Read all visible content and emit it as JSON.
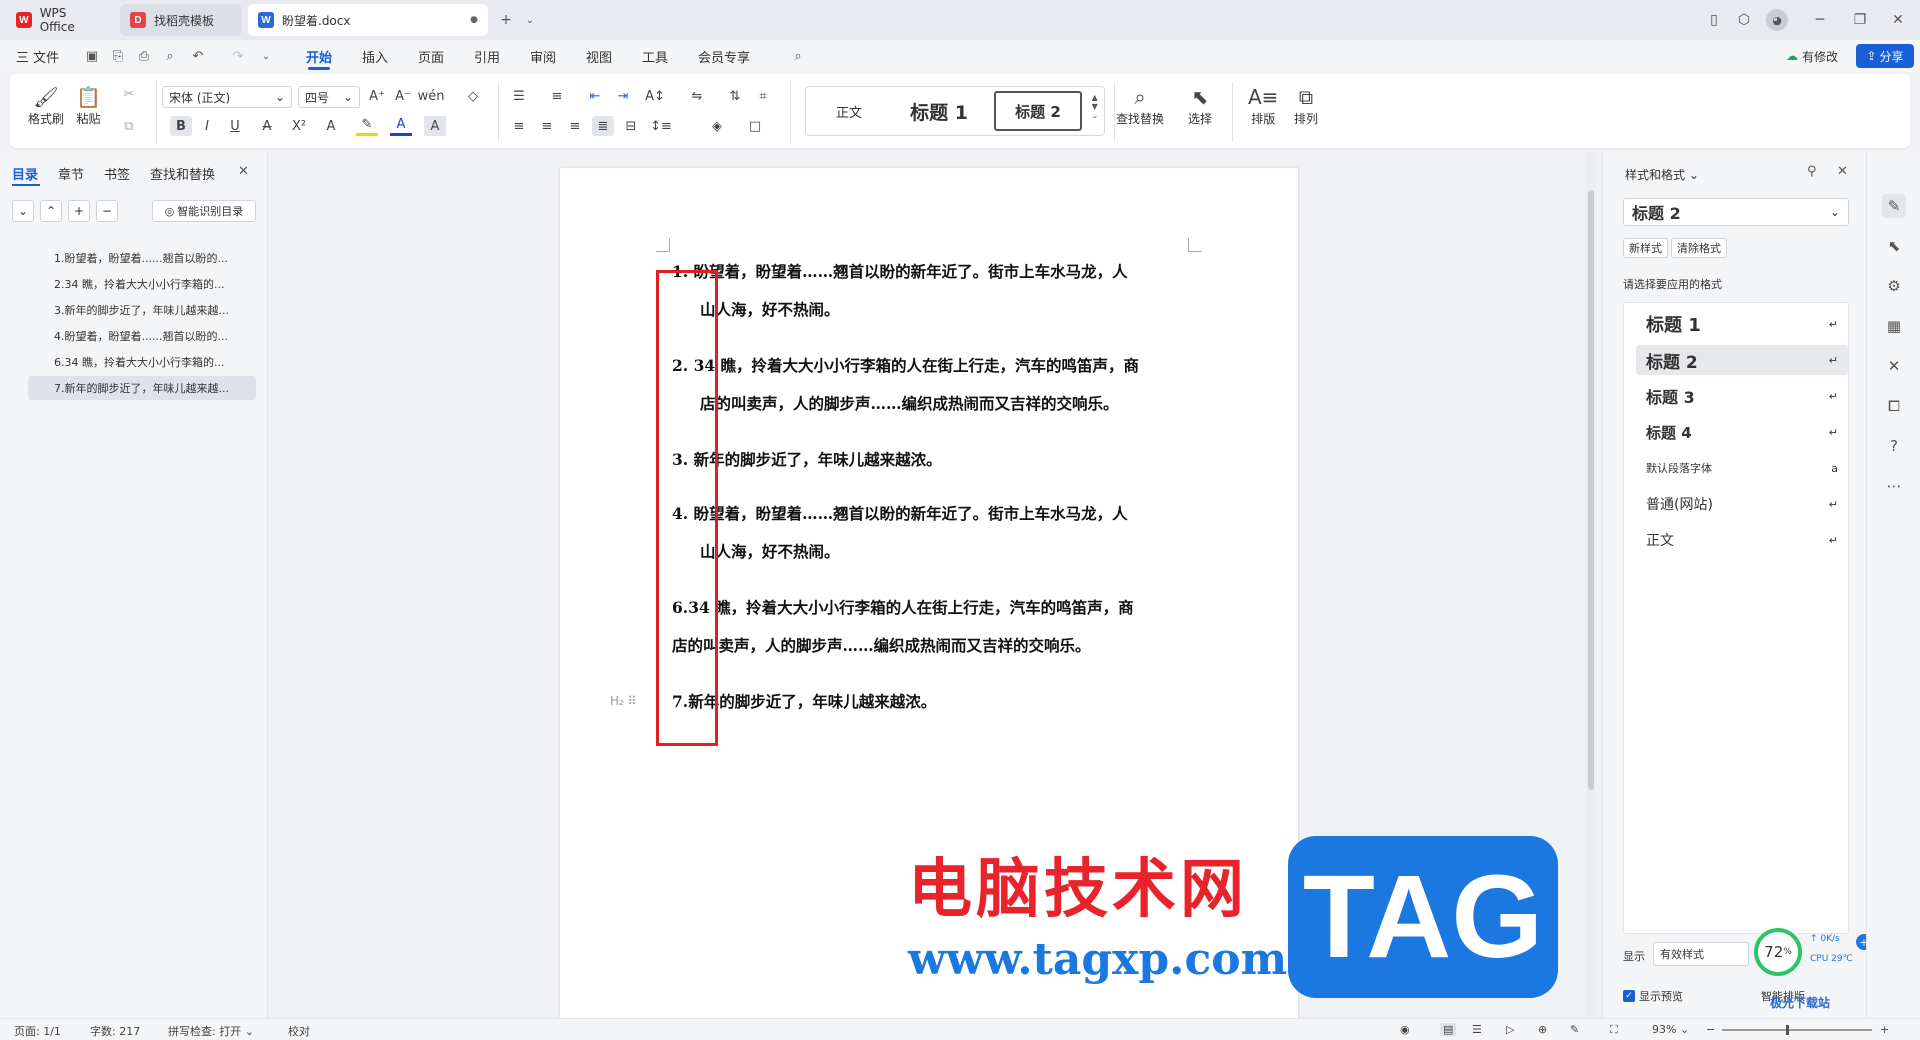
{
  "tabs": [
    {
      "label": "WPS Office",
      "icon": "wps-logo-icon"
    },
    {
      "label": "找稻壳模板",
      "icon": "docer-icon"
    },
    {
      "label": "盼望着.docx",
      "icon": "word-doc-icon"
    }
  ],
  "menu": {
    "file": "三 文件",
    "items": [
      "开始",
      "插入",
      "页面",
      "引用",
      "审阅",
      "视图",
      "工具",
      "会员专享"
    ],
    "active": "开始",
    "modified_label": "有修改",
    "share_label": "分享"
  },
  "ribbon": {
    "format_painter": "格式刷",
    "paste": "粘贴",
    "font_name": "宋体 (正文)",
    "font_size": "四号",
    "styles": [
      "正文",
      "标题 1",
      "标题 2"
    ],
    "find_replace": "查找替换",
    "select": "选择",
    "typeset": "排版",
    "arrange": "排列"
  },
  "left_panel": {
    "tabs": [
      "目录",
      "章节",
      "书签",
      "查找和替换"
    ],
    "smart_toc": "智能识别目录",
    "toc_items": [
      "1.盼望着，盼望着......翘首以盼的...",
      "2.34 瞧，拎着大大小小行李箱的...",
      "3.新年的脚步近了，年味儿越来越...",
      "4.盼望着，盼望着......翘首以盼的...",
      "6.34 瞧，拎着大大小小行李箱的...",
      "7.新年的脚步近了，年味儿越来越..."
    ]
  },
  "document": {
    "paragraphs": [
      {
        "num": "1.",
        "line1": "盼望着，盼望着……翘首以盼的新年近了。街市上车水马龙，人",
        "line2": "山人海，好不热闹。"
      },
      {
        "num": "2.",
        "line1": "34 瞧，拎着大大小小行李箱的人在街上行走，汽车的鸣笛声，商",
        "line2": "店的叫卖声，人的脚步声……编织成热闹而又吉祥的交响乐。"
      },
      {
        "num": "3.",
        "line1": "新年的脚步近了，年味儿越来越浓。"
      },
      {
        "num": "4.",
        "line1": "盼望着，盼望着……翘首以盼的新年近了。街市上车水马龙，人",
        "line2": "山人海，好不热闹。"
      },
      {
        "num": "6.",
        "line1": "34 瞧，拎着大大小小行李箱的人在街上行走，汽车的鸣笛声，商",
        "line2": "店的叫卖声，人的脚步声……编织成热闹而又吉祥的交响乐。"
      },
      {
        "num": "7.",
        "line1": "新年的脚步近了，年味儿越来越浓。"
      }
    ],
    "heading_marker": "H₂"
  },
  "right_panel": {
    "title": "样式和格式",
    "current_style": "标题 2",
    "new_style": "新样式",
    "clear_format": "清除格式",
    "hint": "请选择要应用的格式",
    "styles": [
      "标题 1",
      "标题 2",
      "标题 3",
      "标题 4",
      "默认段落字体",
      "普通(网站)",
      "正文"
    ],
    "show_label": "显示",
    "show_value": "有效样式",
    "preview_label": "显示预览",
    "smart_typeset": "智能排版"
  },
  "perf": {
    "percent": "72",
    "net": "0K/s",
    "cpu": "CPU 29℃"
  },
  "status": {
    "page": "页面: 1/1",
    "words": "字数: 217",
    "spell": "拼写检查: 打开",
    "proof": "校对",
    "zoom": "93%"
  },
  "watermark": {
    "title": "电脑技术网",
    "url": "www.tagxp.com",
    "tag": "TAG",
    "corner": "极光下载站"
  },
  "colors": {
    "accent": "#1a5fd6",
    "highlight_box": "#e02020",
    "watermark_red": "#e8232b",
    "watermark_blue": "#1a78e0"
  }
}
